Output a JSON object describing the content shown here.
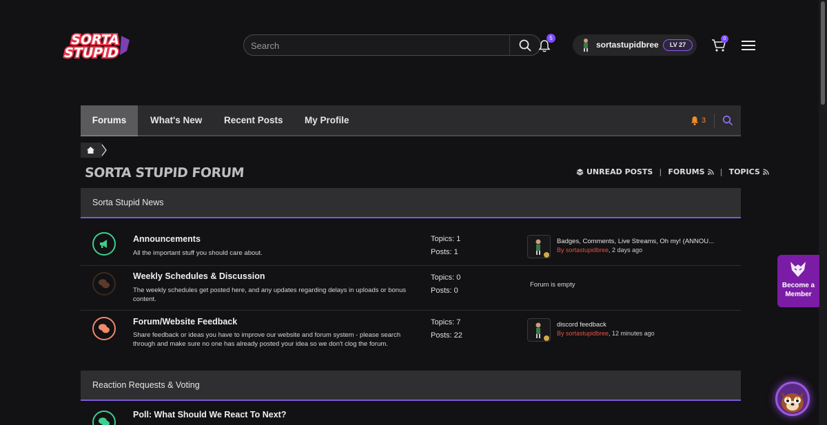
{
  "brand": {
    "logo_line1": "SORTA",
    "logo_line2": "STUPID"
  },
  "header": {
    "search_placeholder": "Search",
    "notifications_count": "5",
    "username": "sortastupidbree",
    "level": "LV 27",
    "cart_count": "0"
  },
  "nav": {
    "tabs": [
      {
        "label": "Forums",
        "active": true
      },
      {
        "label": "What's New"
      },
      {
        "label": "Recent Posts"
      },
      {
        "label": "My Profile"
      }
    ],
    "alert_count": "3"
  },
  "forum": {
    "title": "SORTA STUPID FORUM",
    "quick_links": {
      "unread": "UNREAD POSTS",
      "forums": "FORUMS",
      "topics": "TOPICS"
    }
  },
  "sections": [
    {
      "title": "Sorta Stupid News",
      "forums": [
        {
          "title": "Announcements",
          "description": "All the important stuff you should care about.",
          "topics": "Topics: 1",
          "posts": "Posts: 1",
          "last_post_title": "Badges, Comments, Live Streams, Oh my! (ANNOU...",
          "last_post_author": "By sortastupidbree",
          "last_post_time": ", 2 days ago",
          "icon": "megaphone-icon",
          "color": "#3ecf8e"
        },
        {
          "title": "Weekly Schedules & Discussion",
          "description": "The weekly schedules get posted here, and any updates regarding delays in uploads or bonus content.",
          "topics": "Topics: 0",
          "posts": "Posts: 0",
          "empty_text": "Forum is empty",
          "icon": "chat-bubbles-icon",
          "color": "#5a3a2a"
        },
        {
          "title": "Forum/Website Feedback",
          "description": "Share feedback or ideas you have to improve our website and forum system - please search through and make sure no one has already posted your idea so we don't clog the forum.",
          "topics": "Topics: 7",
          "posts": "Posts: 22",
          "last_post_title": "discord feedback",
          "last_post_author": "By sortastupidbree",
          "last_post_time": ", 12 minutes ago",
          "icon": "chat-bubbles-icon",
          "color": "#f08a6a"
        }
      ]
    },
    {
      "title": "Reaction Requests & Voting",
      "forums": [
        {
          "title": "Poll: What Should We React To Next?",
          "icon": "chat-bubbles-icon",
          "color": "#3ecf8e"
        }
      ]
    }
  ],
  "member_cta": {
    "line1": "Become a",
    "line2": "Member"
  },
  "colors": {
    "accent": "#7a5cd8",
    "alert": "#f28c28",
    "author": "#e05545",
    "member": "#7b1ca6"
  }
}
